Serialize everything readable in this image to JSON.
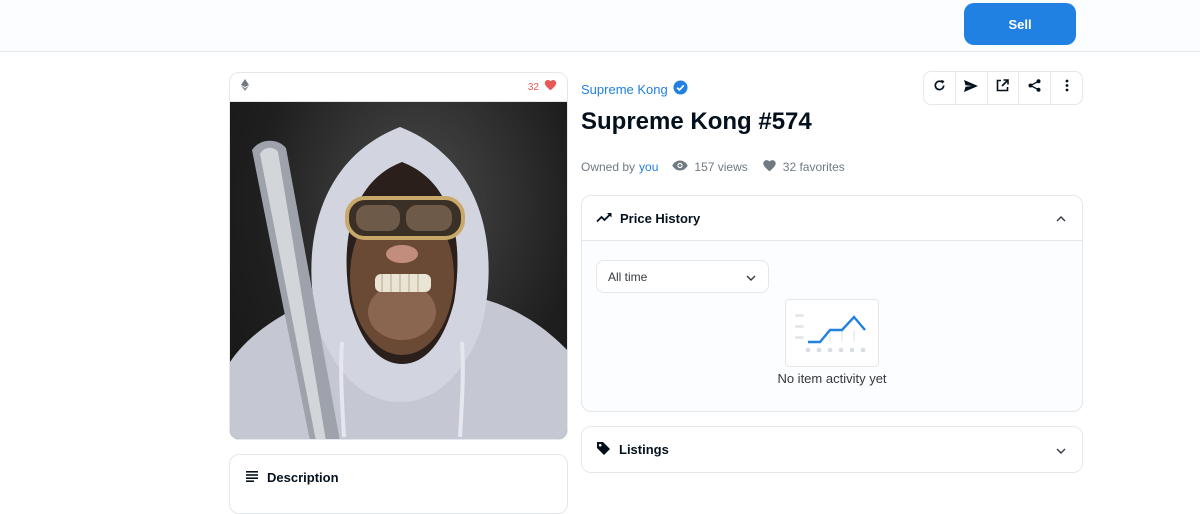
{
  "header": {
    "sell_label": "Sell"
  },
  "media": {
    "chain_icon": "ethereum-icon",
    "favorites_count": "32",
    "heart_color": "#eb5757",
    "image_description_icon": "nft-artwork"
  },
  "description": {
    "label": "Description"
  },
  "item": {
    "collection_name": "Supreme Kong",
    "verified_icon": "verified-badge-icon",
    "title": "Supreme Kong #574",
    "owned_by_label": "Owned by",
    "owner": "you",
    "views": "157 views",
    "favorites": "32 favorites"
  },
  "toolbar": {
    "icons": [
      "refresh-icon",
      "transfer-icon",
      "open-external-icon",
      "share-icon",
      "more-icon"
    ]
  },
  "price_history": {
    "label": "Price History",
    "range_selected": "All time",
    "empty_text": "No item activity yet"
  },
  "listings": {
    "label": "Listings"
  },
  "colors": {
    "accent": "#2081e2",
    "border": "#e5e8eb",
    "text": "#04111d"
  }
}
